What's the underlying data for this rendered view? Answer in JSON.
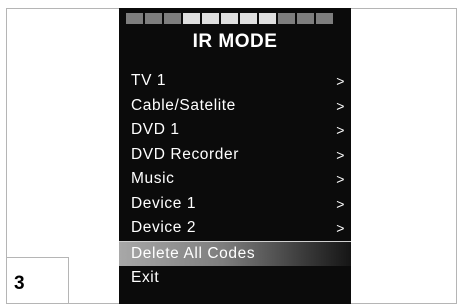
{
  "page_number": "3",
  "screen": {
    "title": "IR MODE",
    "segments": [
      "dim",
      "dim",
      "dim",
      "lit",
      "lit",
      "lit",
      "lit",
      "lit",
      "dim",
      "dim",
      "dim"
    ],
    "items": [
      {
        "label": "TV 1",
        "arrow": ">"
      },
      {
        "label": "Cable/Satelite",
        "arrow": ">"
      },
      {
        "label": "DVD 1",
        "arrow": ">"
      },
      {
        "label": "DVD Recorder",
        "arrow": ">"
      },
      {
        "label": "Music",
        "arrow": ">"
      },
      {
        "label": "Device 1",
        "arrow": ">"
      },
      {
        "label": "Device 2",
        "arrow": ">"
      },
      {
        "label": "Delete All Codes",
        "arrow": "",
        "selected": true
      },
      {
        "label": "Exit",
        "arrow": ""
      }
    ]
  }
}
